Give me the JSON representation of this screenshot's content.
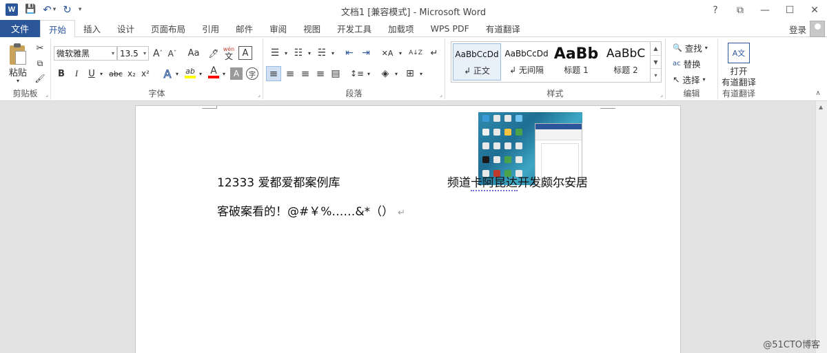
{
  "window": {
    "title": "文档1 [兼容模式] - Microsoft Word",
    "help_label": "?",
    "restore_label": "⧉",
    "minimize_label": "—",
    "maximize_label": "☐",
    "close_label": "✕"
  },
  "qat": {
    "app_logo": "W",
    "save_icon": "💾",
    "undo_icon": "↶",
    "undo_dropdown": "▾",
    "redo_icon": "↻",
    "customize_icon": "▾"
  },
  "tabs": {
    "file": "文件",
    "items": [
      "开始",
      "插入",
      "设计",
      "页面布局",
      "引用",
      "邮件",
      "审阅",
      "视图",
      "开发工具",
      "加载项",
      "WPS PDF",
      "有道翻译"
    ],
    "active_index": 0,
    "login": "登录"
  },
  "ribbon": {
    "clipboard": {
      "label": "剪贴板",
      "paste": "粘贴",
      "paste_arrow": "▾",
      "cut_icon": "✂",
      "copy_icon": "⧉",
      "format_painter_icon": "🖌"
    },
    "font": {
      "label": "字体",
      "font_name": "微软雅黑",
      "font_size": "13.5",
      "grow": "A",
      "grow_sup": "ˆ",
      "shrink": "A",
      "shrink_sup": "ˇ",
      "change_case": "Aa",
      "clear_format": "🖊",
      "phonetic": "wén",
      "phonetic_base": "文",
      "border_char": "A",
      "bold": "B",
      "italic": "I",
      "underline": "U",
      "strike": "abc",
      "subscript": "x₂",
      "superscript": "x²",
      "text_effect": "A",
      "highlight": "ab",
      "font_color": "A",
      "char_shading": "A",
      "enclose": "字"
    },
    "paragraph": {
      "label": "段落",
      "bullets": "☰",
      "numbering": "☷",
      "multilevel": "☵",
      "decrease_indent": "⇤",
      "increase_indent": "⇥",
      "chinese_layout": "✕A",
      "sort": "A↓Z",
      "show_marks": "↵",
      "align_left": "≡",
      "align_center": "≡",
      "align_right": "≡",
      "justify": "≡",
      "distributed": "▤",
      "line_spacing": "↕≡",
      "shading": "◈",
      "borders": "⊞"
    },
    "styles": {
      "label": "样式",
      "items": [
        {
          "sample": "AaBbCcDd",
          "name": "↲ 正文"
        },
        {
          "sample": "AaBbCcDd",
          "name": "↲ 无间隔"
        },
        {
          "sample": "AaBb",
          "name": "标题 1"
        },
        {
          "sample": "AaBbC",
          "name": "标题 2"
        }
      ],
      "scroll_up": "▲",
      "scroll_down": "▼",
      "more": "▾"
    },
    "editing": {
      "label": "编辑",
      "find": "查找",
      "find_icon": "🔍",
      "find_arrow": "▾",
      "replace": "替换",
      "replace_icon": "ac",
      "select": "选择",
      "select_icon": "↖",
      "select_arrow": "▾"
    },
    "youdao": {
      "label": "有道翻译",
      "open_line1": "打开",
      "open_line2": "有道翻译",
      "icon": "A文"
    },
    "launcher": "⌟",
    "collapse": "∧"
  },
  "document": {
    "line1_before": "12333 爱都爱都案例库",
    "line1_after_plain": "频道",
    "line1_after_squiggle": "卡阿昆达",
    "line1_after_rest": "开发颇尔安居",
    "line2": "客破案看的！@#￥%……&*（）",
    "para_mark": "↵"
  },
  "colors": {
    "accent": "#2b579a",
    "highlight_bar": "#ffff00",
    "font_color_bar": "#ff0000"
  },
  "watermark": "@51CTO博客"
}
